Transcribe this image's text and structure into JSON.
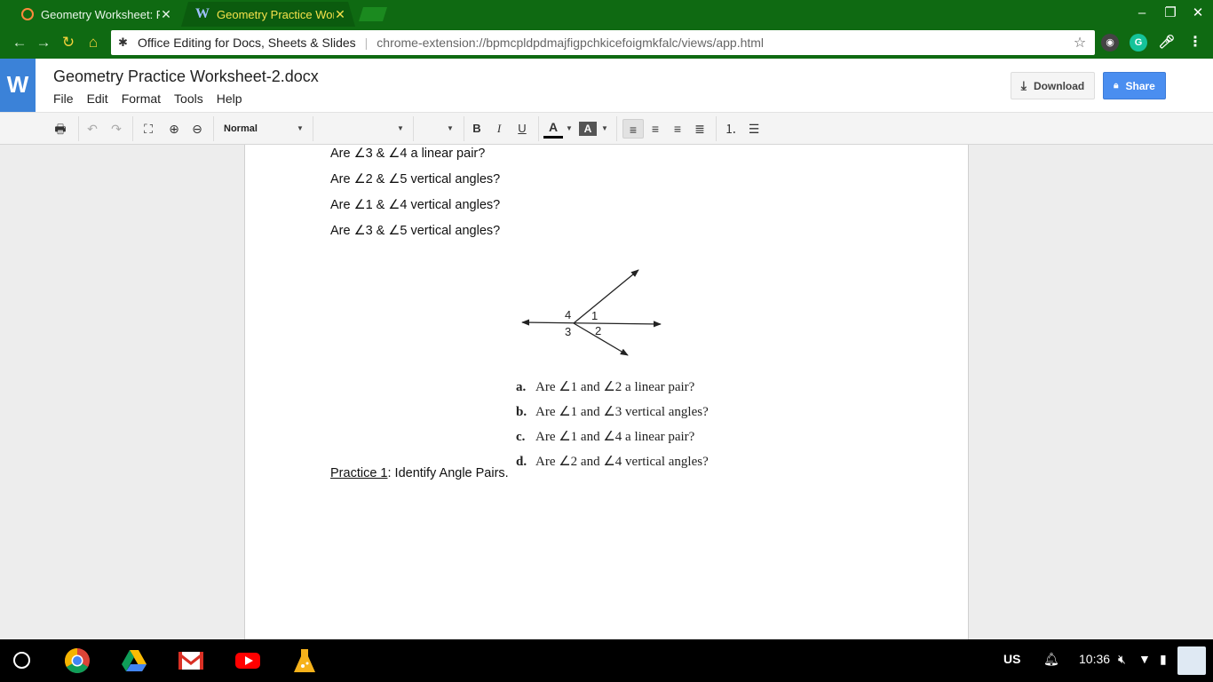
{
  "browser": {
    "tabs": [
      {
        "title": "Geometry Worksheet: PH",
        "favicon": "ring-icon",
        "active": false
      },
      {
        "title": "Geometry Practice Works",
        "favicon": "word-w-icon",
        "active": true
      }
    ],
    "omnibox": {
      "origin": "Office Editing for Docs, Sheets & Slides",
      "url": "chrome-extension://bpmcpldpdmajfigpchkicefoigmkfalc/views/app.html"
    }
  },
  "app": {
    "logo": "W",
    "doc_title": "Geometry Practice Worksheet-2.docx",
    "menu": [
      "File",
      "Edit",
      "Format",
      "Tools",
      "Help"
    ],
    "download_label": "Download",
    "share_label": "Share",
    "colors": {
      "logo_bg": "#3b82d8",
      "share_bg": "#4a8ef0",
      "chrome_green": "#0f6a12"
    }
  },
  "toolbar": {
    "style_select": "Normal",
    "font_select": "",
    "size_select": "",
    "bold": "B",
    "italic": "I",
    "underline": "U",
    "text_color_glyph": "A",
    "highlight_glyph": "A"
  },
  "document": {
    "questions": [
      "Are ∠3 & ∠4 a linear pair?",
      "Are ∠2 & ∠5 vertical angles?",
      "Are ∠1 & ∠4 vertical angles?",
      "Are ∠3 & ∠5 vertical angles?"
    ],
    "figure_labels": {
      "a4": "4",
      "a1": "1",
      "a3": "3",
      "a2": "2"
    },
    "sub_questions": [
      {
        "letter": "a.",
        "text": "Are ∠1 and ∠2 a linear pair?"
      },
      {
        "letter": "b.",
        "text": "Are ∠1 and ∠3 vertical angles?"
      },
      {
        "letter": "c.",
        "text": "Are ∠1 and ∠4 a linear pair?"
      },
      {
        "letter": "d.",
        "text": "Are ∠2 and ∠4 vertical angles?"
      }
    ],
    "practice_label": "Practice 1",
    "practice_text": ":  Identify Angle Pairs."
  },
  "shelf": {
    "apps": [
      "chrome-icon",
      "drive-icon",
      "gmail-icon",
      "youtube-icon",
      "flask-icon"
    ],
    "ime": "US",
    "time": "10:36"
  }
}
